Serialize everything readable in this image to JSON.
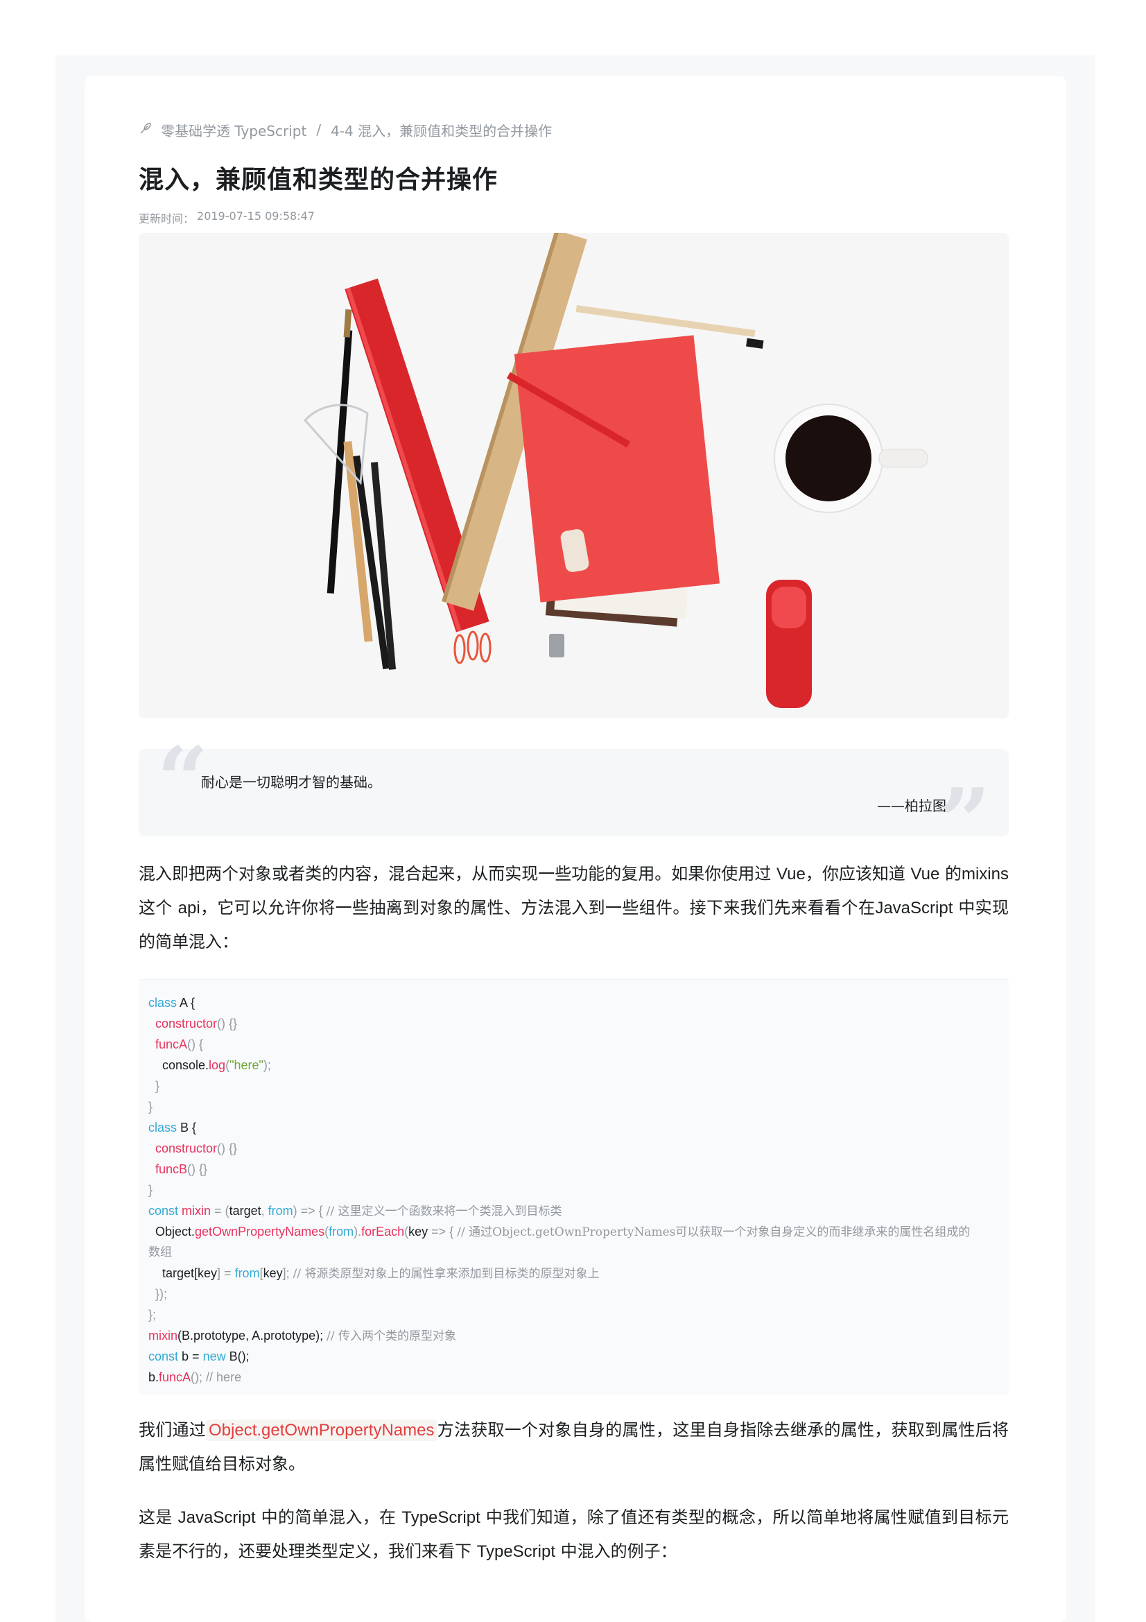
{
  "breadcrumb": {
    "icon": "feather-icon",
    "course": "零基础学透 TypeScript",
    "separator": "/",
    "chapter": "4-4 混入，兼顾值和类型的合并操作"
  },
  "article": {
    "title": "混入，兼顾值和类型的合并操作",
    "update_label": "更新时间：",
    "update_time": "2019-07-15 09:58:47"
  },
  "hero_image": {
    "description_icon": "desk-stationery-image"
  },
  "quote": {
    "text": "耐心是一切聪明才智的基础。",
    "author": "——柏拉图"
  },
  "paragraphs": {
    "p1_a": "混入即把两个对象或者类的内容，混合起来，从而实现一些功能的复用。如果你使用过 ",
    "p1_vue1": "Vue",
    "p1_b": "，你应该知道 ",
    "p1_vue2": "Vue",
    "p1_c": " 的",
    "p1_mixins": "mixins",
    "p1_d": " 这个 ",
    "p1_api": "api",
    "p1_e": "，它可以允许你将一些抽离到对象的属性、方法混入到一些组件。接下来我们先来看看个在",
    "p1_js": "JavaScript",
    "p1_f": " 中实现的简单混入：",
    "p2_a": "我们通过",
    "p2_code": "Object.getOwnPropertyNames",
    "p2_b": "方法获取一个对象自身的属性，这里自身指除去继承的属性，获取到属性后将属性赋值给目标对象。",
    "p3_a": "这是 ",
    "p3_js": "JavaScript",
    "p3_b": " 中的简单混入，在 ",
    "p3_ts": "TypeScript",
    "p3_c": " 中我们知道，除了值还有类型的概念，所以简单地将属性赋值到目标元素是不行的，还要处理类型定义，我们来看下 ",
    "p3_ts2": "TypeScript",
    "p3_d": " 中混入的例子："
  },
  "code": {
    "l1_kw": "class",
    "l1_rest": " A {",
    "l2_fn": "constructor",
    "l2_rest": "() {}",
    "l3_fn": "funcA",
    "l3_rest": "() {",
    "l4_a": "console.",
    "l4_fn": "log",
    "l4_p1": "(",
    "l4_str": "\"here\"",
    "l4_p2": ");",
    "l5": "}",
    "l6": "}",
    "l7_kw": "class",
    "l7_rest": " B {",
    "l8_fn": "constructor",
    "l8_rest": "() {}",
    "l9_fn": "funcB",
    "l9_rest": "() {}",
    "l10": "}",
    "l11_kw": "const",
    "l11_fn": " mixin",
    "l11_eq": " = (",
    "l11_a": "target",
    "l11_b": ", ",
    "l11_c": "from",
    "l11_d": ") => { ",
    "l11_cm": "// 这里定义一个函数来将一个类混入到目标类",
    "l12_a": "Object.",
    "l12_fn": "getOwnPropertyNames",
    "l12_b": "(",
    "l12_c": "from",
    "l12_d": ").",
    "l12_fn2": "forEach",
    "l12_e": "(",
    "l12_f": "key",
    "l12_g": " => { ",
    "l12_cm": "// 通过Object.getOwnPropertyNames可以获取一个对象自身定义的而非继承来的属性名组成的",
    "l13_cm": "数组",
    "l14_a": "target[",
    "l14_b": "key",
    "l14_c": "] = ",
    "l14_d": "from",
    "l14_e": "[",
    "l14_f": "key",
    "l14_g": "]; ",
    "l14_cm": "// 将源类原型对象上的属性拿来添加到目标类的原型对象上",
    "l15": "});",
    "l16": "};",
    "l17_fn": "mixin",
    "l17_a": "(B.prototype, A.prototype); ",
    "l17_cm": "// 传入两个类的原型对象",
    "l18_kw": "const",
    "l18_a": " b = ",
    "l18_kw2": "new",
    "l18_b": " B();",
    "l19_a": "b.",
    "l19_fn": "funcA",
    "l19_b": "(); ",
    "l19_cm": "// here"
  },
  "colors": {
    "keyword": "#33a9d3",
    "function": "#e8315c",
    "string": "#73a73c",
    "comment": "#93999f",
    "inline_code": "#e33d3d"
  }
}
